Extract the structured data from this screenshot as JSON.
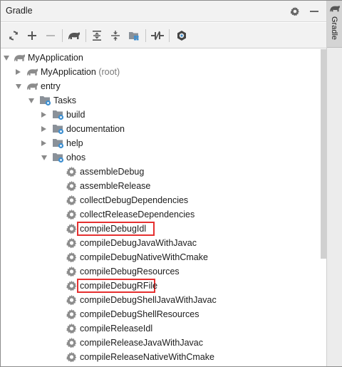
{
  "panel": {
    "title": "Gradle",
    "side_tab_label": "Gradle"
  },
  "toolbar": {
    "buttons": [
      "refresh-icon",
      "plus-icon",
      "minus-icon",
      "elephant-icon",
      "expand-all-icon",
      "collapse-all-icon",
      "group-modules-icon",
      "toggle-offline-icon",
      "settings-circle-icon"
    ]
  },
  "tree": {
    "root": {
      "label": "MyApplication"
    },
    "project_node": {
      "label": "MyApplication",
      "suffix": "(root)"
    },
    "entry_node": {
      "label": "entry"
    },
    "tasks_node": {
      "label": "Tasks"
    },
    "task_groups": [
      "build",
      "documentation",
      "help",
      "ohos"
    ],
    "ohos_tasks": [
      "assembleDebug",
      "assembleRelease",
      "collectDebugDependencies",
      "collectReleaseDependencies",
      "compileDebugIdl",
      "compileDebugJavaWithJavac",
      "compileDebugNativeWithCmake",
      "compileDebugResources",
      "compileDebugRFile",
      "compileDebugShellJavaWithJavac",
      "compileDebugShellResources",
      "compileReleaseIdl",
      "compileReleaseJavaWithJavac",
      "compileReleaseNativeWithCmake"
    ],
    "highlighted_tasks": [
      "compileDebugIdl",
      "compileDebugRFile"
    ]
  },
  "colors": {
    "highlight_border": "#e53030",
    "gear": "#8c8c8c",
    "folder": "#8a9199",
    "badge": "#3d8fd1"
  }
}
